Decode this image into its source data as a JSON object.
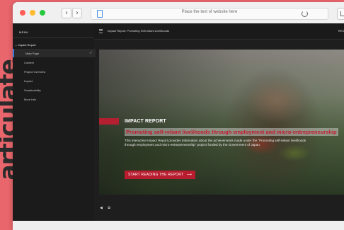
{
  "brand_text": "articulate",
  "browser": {
    "url_text": "Place the text of website here",
    "back_glyph": "‹",
    "forward_glyph": "›"
  },
  "sidebar": {
    "menu_label": "MENU",
    "section_label": "Impact Report",
    "items": [
      {
        "label": "Main Page",
        "active": true
      },
      {
        "label": "Context"
      },
      {
        "label": "Project Overview"
      },
      {
        "label": "Impact"
      },
      {
        "label": "Sustainability"
      },
      {
        "label": "More Info"
      }
    ]
  },
  "topbar": {
    "title": "Impact Report: Promoting Self-reliant Livelihoods",
    "right_label": "RES"
  },
  "hero": {
    "title": "IMPACT REPORT",
    "subtitle": "Promoting self-reliant livelihoods through employment and micro-entrepreneurship",
    "description": "This interactive Impact Report provides information about the achievements made under the \"Promoting self-reliant livelihoods through employment and micro-entrepreneurship\" project funded by the Government of Japan.",
    "cta_label": "START READING THE REPORT",
    "cta_arrow": "⟶"
  },
  "controls": {
    "sound_glyph": "◀",
    "settings_glyph": "✿"
  },
  "icons": {
    "check": "✓",
    "collapse_chevron": "⌄"
  },
  "colors": {
    "page_background": "#e9666c",
    "accent": "#b81c2f",
    "active_nav": "#2c7be5"
  }
}
